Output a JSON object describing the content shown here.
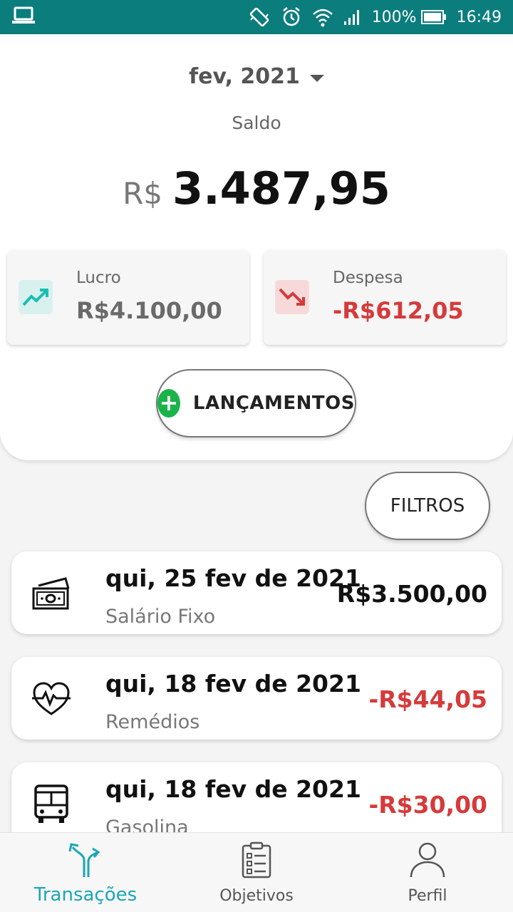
{
  "statusbar": {
    "battery": "100%",
    "time": "16:49"
  },
  "header": {
    "month": "fev, 2021",
    "saldo_label": "Saldo",
    "saldo_currency": "R$",
    "saldo_value": "3.487,95"
  },
  "stats": {
    "profit": {
      "label": "Lucro",
      "value": "R$4.100,00",
      "icon": "trending-up-icon",
      "color": "#1abfb0"
    },
    "expense": {
      "label": "Despesa",
      "value": "-R$612,05",
      "icon": "trending-down-icon",
      "color": "#d63a3a"
    }
  },
  "actions": {
    "lancamentos_label": "LANÇAMENTOS",
    "filtros_label": "FILTROS"
  },
  "transactions": [
    {
      "date": "qui, 25 fev de 2021",
      "description": "Salário Fixo",
      "value": "R$3.500,00",
      "icon": "money-icon",
      "negative": false
    },
    {
      "date": "qui, 18 fev de 2021",
      "description": "Remédios",
      "value": "-R$44,05",
      "icon": "health-heart-icon",
      "negative": true
    },
    {
      "date": "qui, 18 fev de 2021",
      "description": "Gasolina",
      "value": "-R$30,00",
      "icon": "bus-icon",
      "negative": true
    }
  ],
  "nav": {
    "items": [
      {
        "label": "Transações",
        "icon": "transactions-arrows-icon",
        "active": true
      },
      {
        "label": "Objetivos",
        "icon": "clipboard-checklist-icon",
        "active": false
      },
      {
        "label": "Perfil",
        "icon": "person-icon",
        "active": false
      }
    ]
  },
  "colors": {
    "statusbar": "#0b7d7d",
    "accent": "#1aa6b7",
    "positive_btn": "#19b34a",
    "negative": "#d63a3a"
  }
}
